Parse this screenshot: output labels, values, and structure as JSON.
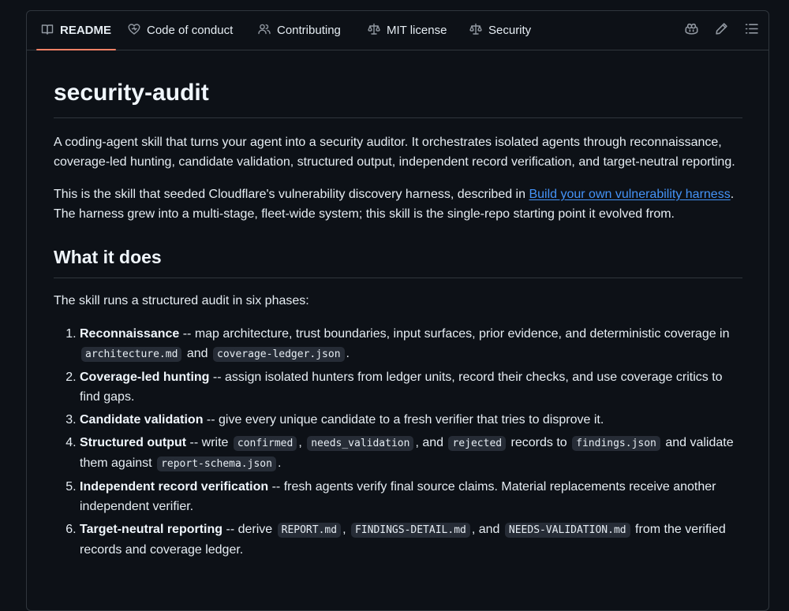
{
  "tabs": [
    {
      "label": "README",
      "icon": "book-icon",
      "active": true
    },
    {
      "label": "Code of conduct",
      "icon": "heart-icon"
    },
    {
      "label": "Contributing",
      "icon": "people-icon"
    },
    {
      "label": "MIT license",
      "icon": "law-icon"
    },
    {
      "label": "Security",
      "icon": "law-icon"
    }
  ],
  "toolbar": [
    "copilot-icon",
    "pencil-icon",
    "outline-list-icon"
  ],
  "readme": {
    "title": "security-audit",
    "intro": "A coding-agent skill that turns your agent into a security auditor. It orchestrates isolated agents through reconnaissance, coverage-led hunting, candidate validation, structured output, independent record verification, and target-neutral reporting.",
    "seed_before": "This is the skill that seeded Cloudflare's vulnerability discovery harness, described in ",
    "seed_link": "Build your own vulnerability harness",
    "seed_after": ". The harness grew into a multi-stage, fleet-wide system; this skill is the single-repo starting point it evolved from.",
    "section_heading": "What it does",
    "section_intro": "The skill runs a structured audit in six phases:",
    "phases": [
      {
        "name": "Reconnaissance",
        "t1": " -- map architecture, trust boundaries, input surfaces, prior evidence, and deterministic coverage in ",
        "c1": "architecture.md",
        "t2": " and ",
        "c2": "coverage-ledger.json",
        "t3": "."
      },
      {
        "name": "Coverage-led hunting",
        "t1": " -- assign isolated hunters from ledger units, record their checks, and use coverage critics to find gaps."
      },
      {
        "name": "Candidate validation",
        "t1": " -- give every unique candidate to a fresh verifier that tries to disprove it."
      },
      {
        "name": "Structured output",
        "t1": " -- write ",
        "c1": "confirmed",
        "t2": ", ",
        "c2": "needs_validation",
        "t3": ", and ",
        "c3": "rejected",
        "t4": " records to ",
        "c4": "findings.json",
        "t5": " and validate them against ",
        "c5": "report-schema.json",
        "t6": "."
      },
      {
        "name": "Independent record verification",
        "t1": " -- fresh agents verify final source claims. Material replacements receive another independent verifier."
      },
      {
        "name": "Target-neutral reporting",
        "t1": " -- derive ",
        "c1": "REPORT.md",
        "t2": ", ",
        "c2": "FINDINGS-DETAIL.md",
        "t3": ", and ",
        "c3": "NEEDS-VALIDATION.md",
        "t4": " from the verified records and coverage ledger."
      }
    ]
  },
  "colors": {
    "background": "#0d1117",
    "border": "#30363d",
    "active_tab_underline": "#f78166",
    "link": "#4493f8",
    "code_bg": "#262c36"
  }
}
